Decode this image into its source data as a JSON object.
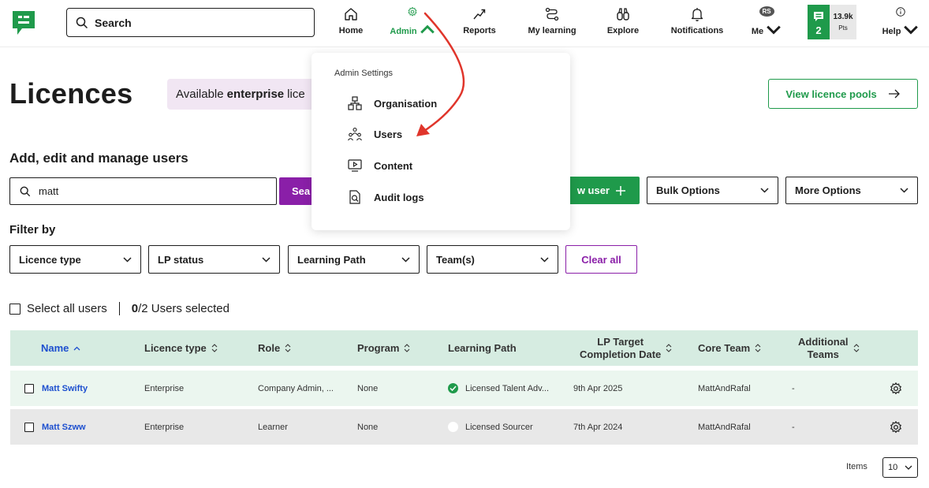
{
  "nav": {
    "search_placeholder": "Search",
    "items": [
      {
        "label": "Home"
      },
      {
        "label": "Admin"
      },
      {
        "label": "Reports"
      },
      {
        "label": "My learning"
      },
      {
        "label": "Explore"
      },
      {
        "label": "Notifications"
      },
      {
        "label": "Me"
      },
      {
        "label": "Help"
      }
    ],
    "avatar_initials": "RS",
    "level": "2",
    "points": "13.9k",
    "points_unit": "Pts"
  },
  "page": {
    "title": "Licences",
    "available_prefix": "Available",
    "available_bold": "enterprise",
    "available_suffix": "lice",
    "view_pools": "View licence pools"
  },
  "manage": {
    "title": "Add, edit and manage users",
    "search_value": "matt",
    "search_button": "Sea",
    "add_user": "w user",
    "bulk_options": "Bulk Options",
    "more_options": "More Options"
  },
  "filters": {
    "title": "Filter by",
    "licence_type": "Licence type",
    "lp_status": "LP status",
    "learning_path": "Learning Path",
    "teams": "Team(s)",
    "clear_all": "Clear all"
  },
  "selection": {
    "select_all": "Select all users",
    "selected_count": "0",
    "selected_suffix": "/2 Users selected"
  },
  "table": {
    "columns": {
      "name": "Name",
      "licence_type": "Licence type",
      "role": "Role",
      "program": "Program",
      "learning_path": "Learning Path",
      "lp_target_1": "LP Target",
      "lp_target_2": "Completion Date",
      "core_team": "Core Team",
      "additional_1": "Additional",
      "additional_2": "Teams"
    },
    "rows": [
      {
        "name": "Matt Swifty",
        "licence": "Enterprise",
        "role": "Company Admin, ...",
        "program": "None",
        "lp": "Licensed Talent Adv...",
        "target": "9th Apr 2025",
        "core_team": "MattAndRafal",
        "additional": "-"
      },
      {
        "name": "Matt Szww",
        "licence": "Enterprise",
        "role": "Learner",
        "program": "None",
        "lp": "Licensed Sourcer",
        "target": "7th Apr 2024",
        "core_team": "MattAndRafal",
        "additional": "-"
      }
    ]
  },
  "pagination": {
    "items_label": "Items",
    "page_size": "10"
  },
  "admin_menu": {
    "header": "Admin Settings",
    "items": [
      {
        "label": "Organisation",
        "icon": "organisation-icon"
      },
      {
        "label": "Users",
        "icon": "users-icon"
      },
      {
        "label": "Content",
        "icon": "content-icon"
      },
      {
        "label": "Audit logs",
        "icon": "audit-logs-icon"
      }
    ]
  },
  "colors": {
    "brand_green": "#1f9a4b",
    "accent_purple": "#8a1fa8",
    "link_blue": "#1d4fcf",
    "annotation_red": "#e0352b"
  }
}
